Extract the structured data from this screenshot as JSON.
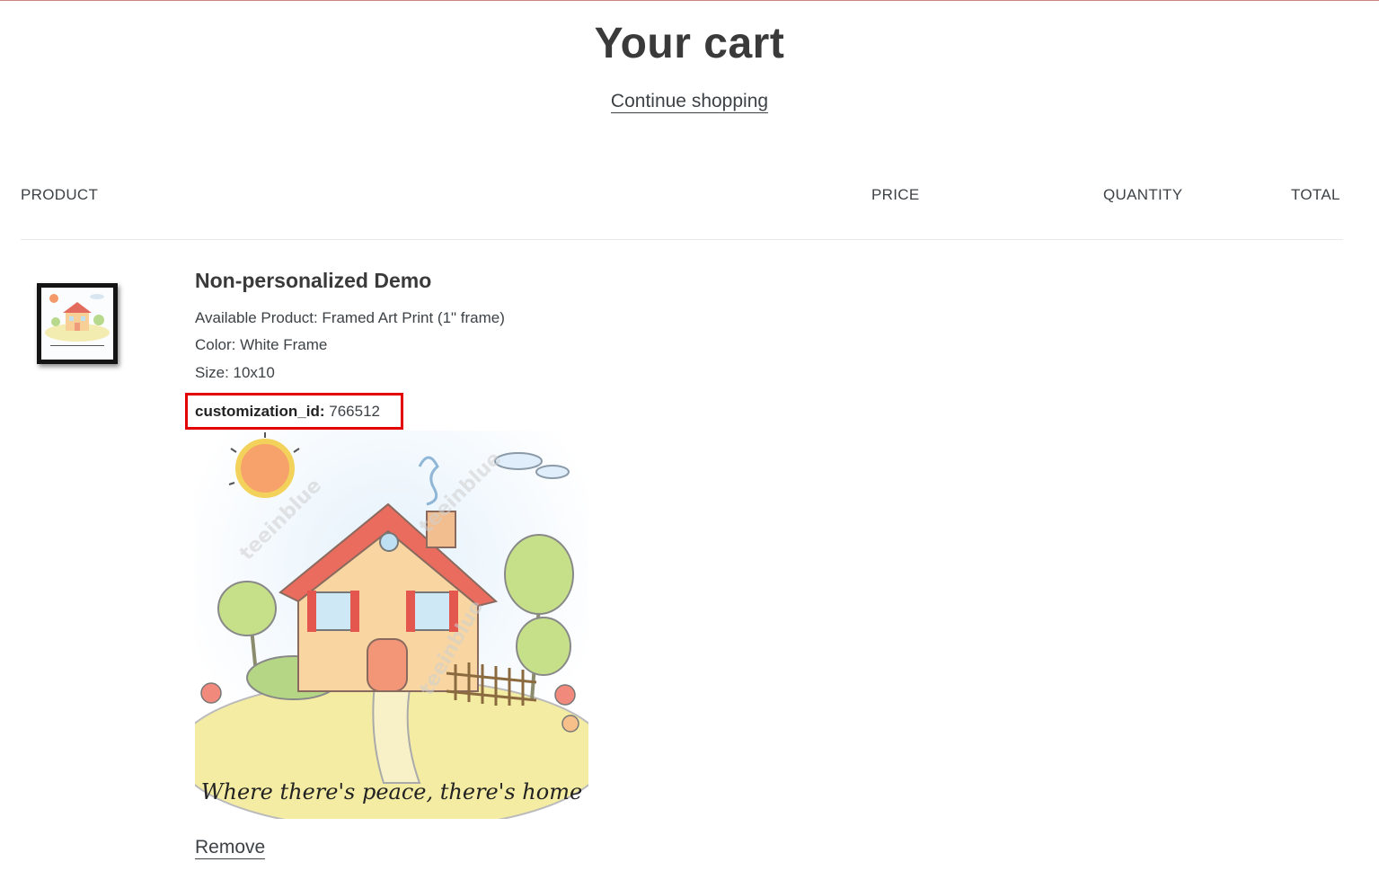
{
  "page": {
    "title": "Your cart",
    "continue_label": "Continue shopping"
  },
  "table": {
    "headers": {
      "product": "PRODUCT",
      "price": "PRICE",
      "quantity": "QUANTITY",
      "total": "TOTAL"
    }
  },
  "item": {
    "title": "Non-personalized Demo",
    "properties": [
      {
        "label": "Available Product",
        "value": "Framed Art Print (1\" frame)",
        "text": "Available Product: Framed Art Print (1\" frame)"
      },
      {
        "label": "Color",
        "value": "White Frame",
        "text": "Color: White Frame"
      },
      {
        "label": "Size",
        "value": "10x10",
        "text": "Size: 10x10"
      }
    ],
    "customization": {
      "key": "customization_id:",
      "value": "766512"
    },
    "image": {
      "caption": "Where there's peace, there's home",
      "watermark": "teeinblue"
    },
    "remove_label": "Remove"
  },
  "colors": {
    "highlight_border": "#e30000",
    "text": "#3d4246",
    "top_rule": "#c9877f"
  }
}
